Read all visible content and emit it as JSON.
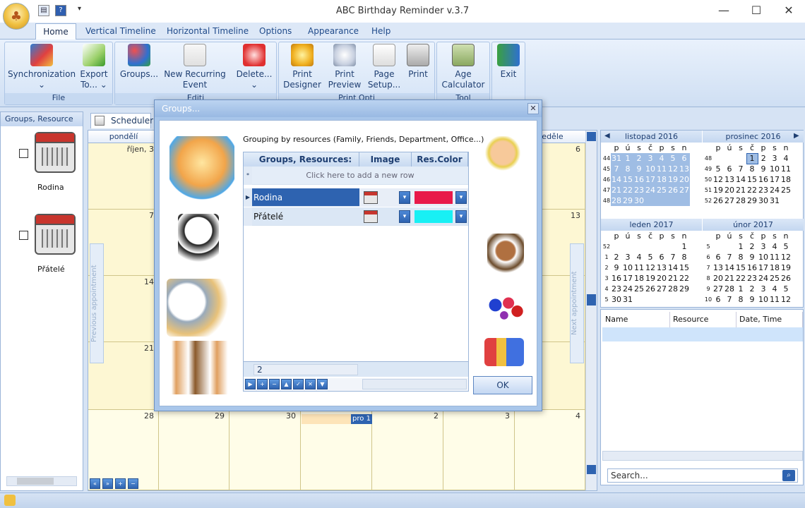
{
  "window": {
    "title": "ABC Birthday Reminder v.3.7"
  },
  "tabs": [
    "Home",
    "Vertical Timeline",
    "Horizontal Timeline",
    "Options",
    "Appearance",
    "Help"
  ],
  "ribbon": {
    "buttons": [
      {
        "label1": "Synchronization",
        "label2": "⌄"
      },
      {
        "label1": "Export",
        "label2": "To... ⌄"
      },
      {
        "label1": "Groups...",
        "label2": ""
      },
      {
        "label1": "New Recurring",
        "label2": "Event"
      },
      {
        "label1": "Delete...",
        "label2": "⌄"
      },
      {
        "label1": "Print",
        "label2": "Designer"
      },
      {
        "label1": "Print",
        "label2": "Preview"
      },
      {
        "label1": "Page",
        "label2": "Setup..."
      },
      {
        "label1": "Print",
        "label2": ""
      },
      {
        "label1": "Age",
        "label2": "Calculator"
      },
      {
        "label1": "Exit",
        "label2": ""
      }
    ],
    "group_labels": [
      "File",
      "Editi",
      "Print Opti",
      "Tool"
    ]
  },
  "left_panel": {
    "header": "Groups, Resource",
    "groups": [
      {
        "name": "Rodina"
      },
      {
        "name": "Přátelé"
      }
    ]
  },
  "scheduler": {
    "tab": "Scheduler",
    "day_headers": [
      "pondělí",
      "",
      "",
      "",
      "",
      "",
      "neděle"
    ],
    "cells": [
      "říjen, 3",
      "",
      "",
      "",
      "",
      "",
      "6",
      "7",
      "",
      "",
      "",
      "",
      "",
      "13",
      "14",
      "",
      "",
      "",
      "",
      "",
      "20",
      "21",
      "",
      "",
      "",
      "",
      "",
      "27",
      "28",
      "29",
      "30",
      "",
      "2",
      "3",
      "4"
    ],
    "event_label": "pro 1",
    "prev_label": "Previous appointment",
    "next_label": "Next appointment"
  },
  "calendars": [
    {
      "title": "listopad 2016",
      "days": [
        "p",
        "ú",
        "s",
        "č",
        "p",
        "s",
        "n"
      ],
      "weeks": [
        {
          "wk": "44",
          "d": [
            "31",
            "1",
            "2",
            "3",
            "4",
            "5",
            "6"
          ]
        },
        {
          "wk": "45",
          "d": [
            "7",
            "8",
            "9",
            "10",
            "11",
            "12",
            "13"
          ]
        },
        {
          "wk": "46",
          "d": [
            "14",
            "15",
            "16",
            "17",
            "18",
            "19",
            "20"
          ]
        },
        {
          "wk": "47",
          "d": [
            "21",
            "22",
            "23",
            "24",
            "25",
            "26",
            "27"
          ]
        },
        {
          "wk": "48",
          "d": [
            "28",
            "29",
            "30",
            "",
            "",
            "",
            ""
          ]
        }
      ]
    },
    {
      "title": "prosinec 2016",
      "days": [
        "p",
        "ú",
        "s",
        "č",
        "p",
        "s",
        "n"
      ],
      "weeks": [
        {
          "wk": "48",
          "d": [
            "",
            "",
            "",
            "1",
            "2",
            "3",
            "4"
          ]
        },
        {
          "wk": "49",
          "d": [
            "5",
            "6",
            "7",
            "8",
            "9",
            "10",
            "11"
          ]
        },
        {
          "wk": "50",
          "d": [
            "12",
            "13",
            "14",
            "15",
            "16",
            "17",
            "18"
          ]
        },
        {
          "wk": "51",
          "d": [
            "19",
            "20",
            "21",
            "22",
            "23",
            "24",
            "25"
          ]
        },
        {
          "wk": "52",
          "d": [
            "26",
            "27",
            "28",
            "29",
            "30",
            "31",
            ""
          ]
        }
      ]
    },
    {
      "title": "leden 2017",
      "days": [
        "p",
        "ú",
        "s",
        "č",
        "p",
        "s",
        "n"
      ],
      "weeks": [
        {
          "wk": "52",
          "d": [
            "",
            "",
            "",
            "",
            "",
            "",
            "1"
          ]
        },
        {
          "wk": "1",
          "d": [
            "2",
            "3",
            "4",
            "5",
            "6",
            "7",
            "8"
          ]
        },
        {
          "wk": "2",
          "d": [
            "9",
            "10",
            "11",
            "12",
            "13",
            "14",
            "15"
          ]
        },
        {
          "wk": "3",
          "d": [
            "16",
            "17",
            "18",
            "19",
            "20",
            "21",
            "22"
          ]
        },
        {
          "wk": "4",
          "d": [
            "23",
            "24",
            "25",
            "26",
            "27",
            "28",
            "29"
          ]
        },
        {
          "wk": "5",
          "d": [
            "30",
            "31",
            "",
            "",
            "",
            "",
            ""
          ]
        }
      ]
    },
    {
      "title": "únor 2017",
      "days": [
        "p",
        "ú",
        "s",
        "č",
        "p",
        "s",
        "n"
      ],
      "weeks": [
        {
          "wk": "5",
          "d": [
            "",
            "",
            "1",
            "2",
            "3",
            "4",
            "5"
          ]
        },
        {
          "wk": "6",
          "d": [
            "6",
            "7",
            "8",
            "9",
            "10",
            "11",
            "12"
          ]
        },
        {
          "wk": "7",
          "d": [
            "13",
            "14",
            "15",
            "16",
            "17",
            "18",
            "19"
          ]
        },
        {
          "wk": "8",
          "d": [
            "20",
            "21",
            "22",
            "23",
            "24",
            "25",
            "26"
          ]
        },
        {
          "wk": "9",
          "d": [
            "27",
            "28",
            "1",
            "2",
            "3",
            "4",
            "5"
          ]
        },
        {
          "wk": "10",
          "d": [
            "6",
            "7",
            "8",
            "9",
            "10",
            "11",
            "12"
          ]
        }
      ]
    }
  ],
  "list": {
    "columns": [
      "Name",
      "Resource",
      "Date, Time"
    ]
  },
  "search": {
    "placeholder": "Search..."
  },
  "dialog": {
    "title": "Groups...",
    "instruction": "Grouping by resources (Family, Friends, Department, Office...)",
    "columns": [
      "Groups, Resources:",
      "Image",
      "Res.Color"
    ],
    "new_row_text": "Click here to add a new row",
    "rows": [
      {
        "name": "Rodina",
        "color": "#e8194a"
      },
      {
        "name": "Přátelé",
        "color": "#18f0f4"
      }
    ],
    "count": "2",
    "ok_label": "OK"
  },
  "colors": {
    "accent": "#2e63b0",
    "ribbon": "#dde8f7",
    "schedule_bg": "#fdf7d3"
  }
}
